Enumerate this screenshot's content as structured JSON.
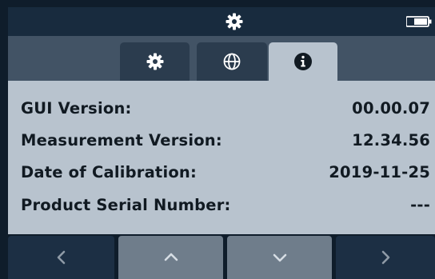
{
  "header": {
    "status_icon": "gear-icon",
    "battery_icon": "battery-icon"
  },
  "tabs": [
    {
      "icon": "gear-icon",
      "active": false
    },
    {
      "icon": "globe-icon",
      "active": false
    },
    {
      "icon": "info-icon",
      "active": true
    }
  ],
  "info": {
    "gui_version": {
      "label": "GUI Version:",
      "value": "00.00.07"
    },
    "measurement_version": {
      "label": "Measurement Version:",
      "value": "12.34.56"
    },
    "date_of_calibration": {
      "label": "Date of Calibration:",
      "value": "2019-11-25"
    },
    "product_serial_number": {
      "label": "Product Serial Number:",
      "value": "---"
    }
  },
  "nav": [
    {
      "icon": "chevron-left-icon"
    },
    {
      "icon": "chevron-up-icon"
    },
    {
      "icon": "chevron-down-icon"
    },
    {
      "icon": "chevron-right-icon"
    }
  ],
  "colors": {
    "status_bar": "#182b3e",
    "tab_row": "#425365",
    "tab_inactive": "#2b3c4e",
    "panel": "#b8c3ce",
    "nav_dark": "#1c2f44",
    "nav_grey": "#6f7d8b",
    "text": "#111a22"
  }
}
